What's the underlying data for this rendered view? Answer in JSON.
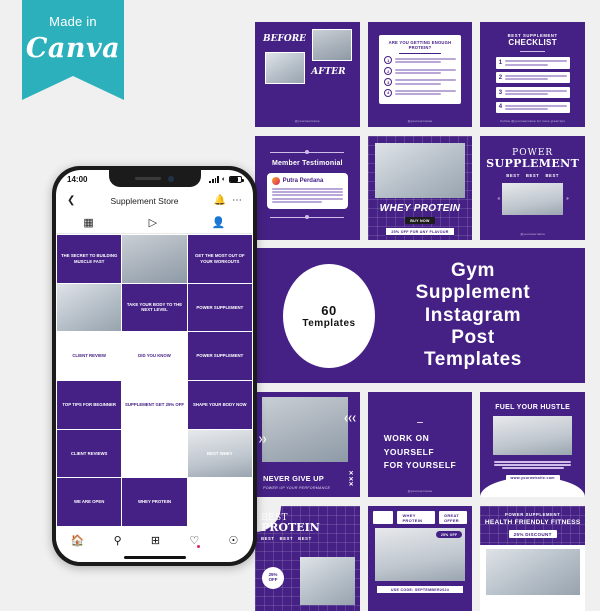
{
  "badge": {
    "made_in": "Made in",
    "brand": "Canva"
  },
  "phone": {
    "status": {
      "time": "14:00",
      "signal_icon": "signal-bars-icon",
      "wifi_icon": "wifi-icon",
      "battery_icon": "battery-icon"
    },
    "appbar": {
      "back_icon": "chevron-left-icon",
      "title": "Supplement Store",
      "bell_icon": "bell-icon",
      "more_icon": "more-horizontal-icon"
    },
    "tabs": [
      {
        "name": "grid-tab",
        "icon": "grid-icon"
      },
      {
        "name": "reels-tab",
        "icon": "play-triangle-icon"
      },
      {
        "name": "tagged-tab",
        "icon": "person-frame-icon"
      }
    ],
    "feed": [
      {
        "label": "THE SECRET TO BUILDING MUSCLE FAST",
        "style": "purple"
      },
      {
        "label": "",
        "style": "photo"
      },
      {
        "label": "GET THE MOST OUT OF YOUR WORKOUTS",
        "style": "purple"
      },
      {
        "label": "",
        "style": "photo2"
      },
      {
        "label": "TAKE YOUR BODY TO THE NEXT LEVEL",
        "style": "purple"
      },
      {
        "label": "POWER SUPPLEMENT",
        "style": "purple"
      },
      {
        "label": "CLIENT REVIEW",
        "style": "light"
      },
      {
        "label": "DID YOU KNOW",
        "style": "light"
      },
      {
        "label": "POWER SUPPLEMENT",
        "style": "purple"
      },
      {
        "label": "TOP TIPS FOR BEGINNER",
        "style": "purple"
      },
      {
        "label": "SUPPLEMENT GET 25% OFF",
        "style": "light"
      },
      {
        "label": "SHAPE YOUR BODY NOW",
        "style": "purple"
      },
      {
        "label": "CLIENT REVIEWS",
        "style": "purple"
      },
      {
        "label": "",
        "style": "light"
      },
      {
        "label": "BEST WHEY",
        "style": "photo3"
      },
      {
        "label": "WE ARE OPEN",
        "style": "purple"
      },
      {
        "label": "WHEY PROTEIN",
        "style": "purple"
      }
    ],
    "nav": [
      {
        "name": "home-nav",
        "icon": "home-icon"
      },
      {
        "name": "search-nav",
        "icon": "search-icon"
      },
      {
        "name": "add-post-nav",
        "icon": "plus-square-icon"
      },
      {
        "name": "activity-nav",
        "icon": "heart-icon"
      },
      {
        "name": "profile-nav",
        "icon": "person-circle-icon"
      }
    ]
  },
  "templates": {
    "row1": [
      {
        "name": "before-after-card",
        "title_a": "BEFORE",
        "title_b": "AFTER",
        "watermark": "@yourusername"
      },
      {
        "name": "protein-question-card",
        "heading": "ARE YOU GETTING ENOUGH PROTEIN?",
        "items": [
          "1",
          "2",
          "3",
          "4"
        ],
        "watermark": "@yourusername"
      },
      {
        "name": "supplement-checklist-card",
        "eyebrow": "BEST SUPPLEMENT",
        "heading": "CHECKLIST",
        "items": [
          "1",
          "2",
          "3",
          "4"
        ],
        "footer": "Follow @yourusername for more great tips"
      }
    ],
    "row2": [
      {
        "name": "member-testimonial-card",
        "heading": "Member Testimonial",
        "person": "Putra Perdana"
      },
      {
        "name": "whey-protein-card",
        "heading": "WHEY PROTEIN",
        "cta": "BUY NOW",
        "offer": "25% OFF FOR ANY FLAVOUR"
      },
      {
        "name": "power-supplement-card",
        "line1": "POWER",
        "line2": "SUPPLEMENT",
        "tags": [
          "BEST",
          "BEST",
          "BEST"
        ],
        "watermark": "@yourusername"
      }
    ],
    "banner": {
      "name": "title-banner",
      "circle_count": "60",
      "circle_label": "Templates",
      "lines": [
        "Gym",
        "Supplement",
        "Instagram",
        "Post",
        "Templates"
      ]
    },
    "row3": [
      {
        "name": "never-give-up-card",
        "heading": "NEVER GIVE UP",
        "sub": "POWER UP YOUR PERFORMANCE"
      },
      {
        "name": "work-on-yourself-card",
        "icon": "dumbbell-icon",
        "lines": [
          "WORK ON",
          "YOURSELF",
          "FOR YOURSELF"
        ],
        "watermark": "@yourusername"
      },
      {
        "name": "fuel-your-hustle-card",
        "heading": "FUEL YOUR HUSTLE",
        "website": "www.yourwebsite.com"
      }
    ],
    "row4": [
      {
        "name": "best-protein-card",
        "line1": "BEST",
        "line2": "PROTEIN",
        "tags": [
          "BEST",
          "BEST",
          "BEST"
        ],
        "badge_top": "25%",
        "badge_bottom": "OFF"
      },
      {
        "name": "whey-great-offer-card",
        "label_a": "WHEY PROTEIN",
        "label_b": "GREAT OFFER",
        "badge": "25% OFF",
        "code": "USE CODE: SEPTEMBER2024"
      },
      {
        "name": "health-friendly-fitness-card",
        "eyebrow": "POWER SUPPLEMENT",
        "heading": "HEALTH FRIENDLY FITNESS",
        "discount": "25% DISCOUNT"
      }
    ]
  },
  "colors": {
    "purple": "#452185",
    "teal": "#2cb1bc",
    "background": "#f0f0f0",
    "accent_dot": "#e0245e"
  }
}
